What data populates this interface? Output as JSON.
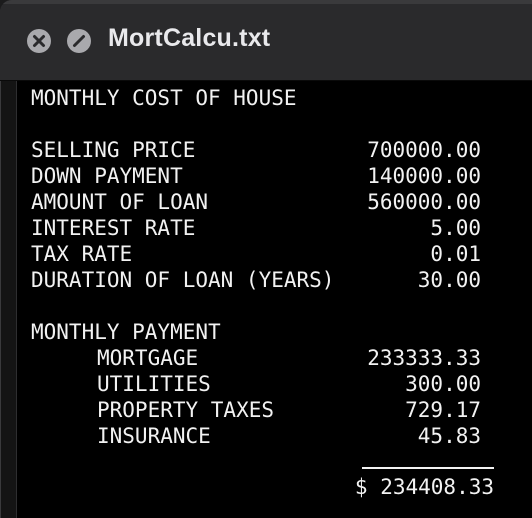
{
  "window": {
    "title": "MortCalcu.txt"
  },
  "document": {
    "heading": "MONTHLY COST OF HOUSE",
    "inputs": [
      {
        "label": "SELLING PRICE",
        "value": "700000.00"
      },
      {
        "label": "DOWN PAYMENT",
        "value": "140000.00"
      },
      {
        "label": "AMOUNT OF LOAN",
        "value": "560000.00"
      },
      {
        "label": "INTEREST RATE",
        "value": "5.00"
      },
      {
        "label": "TAX RATE",
        "value": "0.01"
      },
      {
        "label": "DURATION OF LOAN (YEARS)",
        "value": "30.00"
      }
    ],
    "payment_heading": "MONTHLY PAYMENT",
    "payments": [
      {
        "label": "MORTGAGE",
        "value": "233333.33"
      },
      {
        "label": "UTILITIES",
        "value": "300.00"
      },
      {
        "label": "PROPERTY TAXES",
        "value": "729.17"
      },
      {
        "label": "INSURANCE",
        "value": "45.83"
      }
    ],
    "total": "$ 234408.33"
  },
  "icons": {
    "close": "close-icon",
    "minimize": "minimize-icon"
  }
}
